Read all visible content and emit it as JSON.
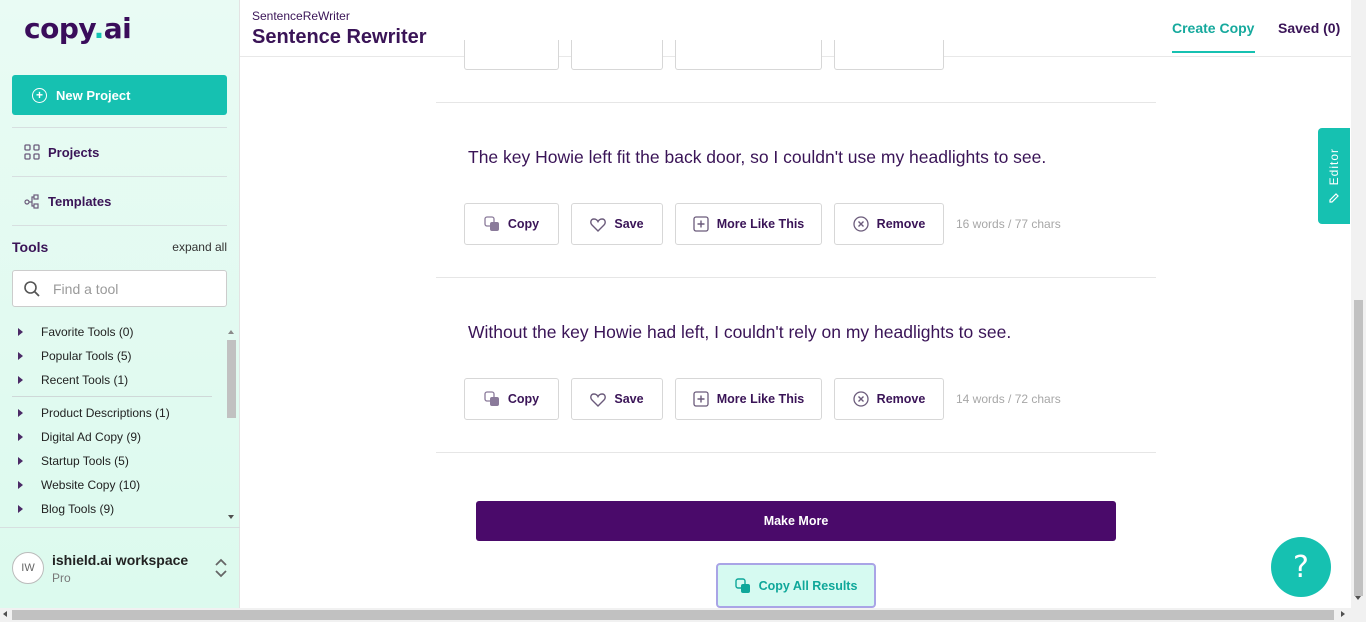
{
  "brand": {
    "logo_prefix": "copy",
    "logo_dot": ".",
    "logo_suffix": "ai",
    "accent": "#16c1b1",
    "primary": "#4a0a6a"
  },
  "sidebar": {
    "new_project_label": "New Project",
    "nav": [
      {
        "label": "Projects"
      },
      {
        "label": "Templates"
      }
    ],
    "tools_title": "Tools",
    "expand_all": "expand all",
    "search_placeholder": "Find a tool",
    "tool_items": [
      {
        "label": "Favorite Tools (0)"
      },
      {
        "label": "Popular Tools (5)"
      },
      {
        "label": "Recent Tools (1)"
      },
      {
        "label": "Product Descriptions (1)"
      },
      {
        "label": "Digital Ad Copy (9)"
      },
      {
        "label": "Startup Tools (5)"
      },
      {
        "label": "Website Copy (10)"
      },
      {
        "label": "Blog Tools (9)"
      }
    ],
    "workspace": {
      "initials": "IW",
      "name": "ishield.ai workspace",
      "plan": "Pro"
    }
  },
  "header": {
    "breadcrumb": "SentenceReWriter",
    "title": "Sentence Rewriter",
    "tabs": [
      {
        "label": "Create Copy",
        "active": true
      },
      {
        "label": "Saved (0)",
        "active": false
      }
    ]
  },
  "editor_tab": "Editor",
  "results": [
    {
      "text": "The key Howie left fit the back door, so I couldn't use my headlights to see.",
      "count": "16 words / 77 chars"
    },
    {
      "text": "Without the key Howie had left, I couldn't rely on my headlights to see.",
      "count": "14 words / 72 chars"
    }
  ],
  "actions": {
    "copy": "Copy",
    "save": "Save",
    "more_like_this": "More Like This",
    "remove": "Remove"
  },
  "make_more": "Make More",
  "copy_all": "Copy All Results",
  "help": "?"
}
